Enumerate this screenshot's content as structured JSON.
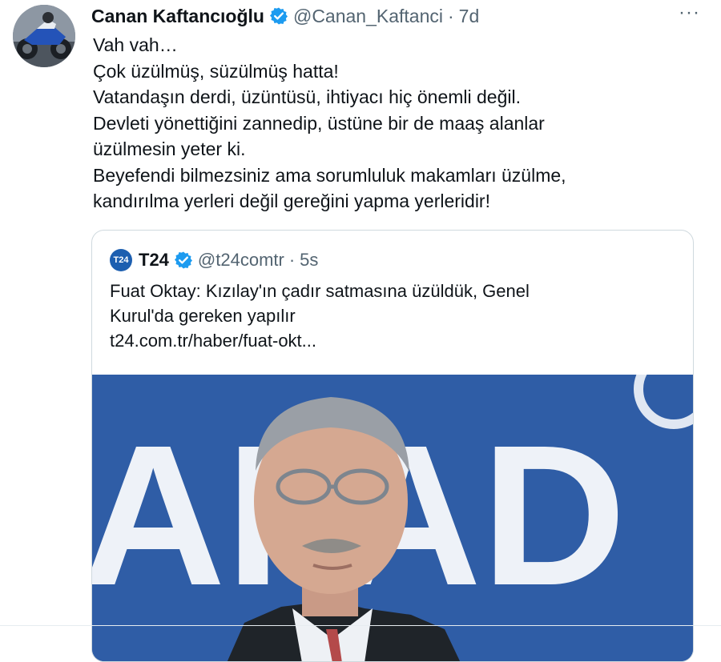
{
  "tweet": {
    "author": {
      "name": "Canan Kaftancıoğlu",
      "handle": "@Canan_Kaftanci",
      "time": "7d",
      "verified": true,
      "avatar": "motorcycle-avatar"
    },
    "more_label": "···",
    "text_lines": [
      "Vah vah…",
      "Çok üzülmüş, süzülmüş hatta!",
      "Vatandaşın derdi, üzüntüsü, ihtiyacı hiç önemli değil.",
      "Devleti yönettiğini zannedip, üstüne bir de maaş alanlar",
      "üzülmesin yeter ki.",
      "Beyefendi bilmezsiniz ama sorumluluk makamları üzülme,",
      "kandırılma yerleri değil gereğini yapma yerleridir!"
    ],
    "quote": {
      "logo_text": "T24",
      "name": "T24",
      "handle": "@t24comtr",
      "time": "5s",
      "verified": true,
      "text_lines": [
        "Fuat Oktay: Kızılay'ın çadır satmasına üzüldük, Genel",
        "Kurul'da gereken yapılır"
      ],
      "link": "t24.com.tr/haber/fuat-okt...",
      "image": {
        "background_text": "AFAD",
        "colors": {
          "background": "#2f5da6",
          "letters": "#ffffff"
        }
      }
    }
  },
  "colors": {
    "text": "#0f1419",
    "muted": "#536471",
    "verified": "#1d9bf0",
    "border": "#cfd9de"
  }
}
